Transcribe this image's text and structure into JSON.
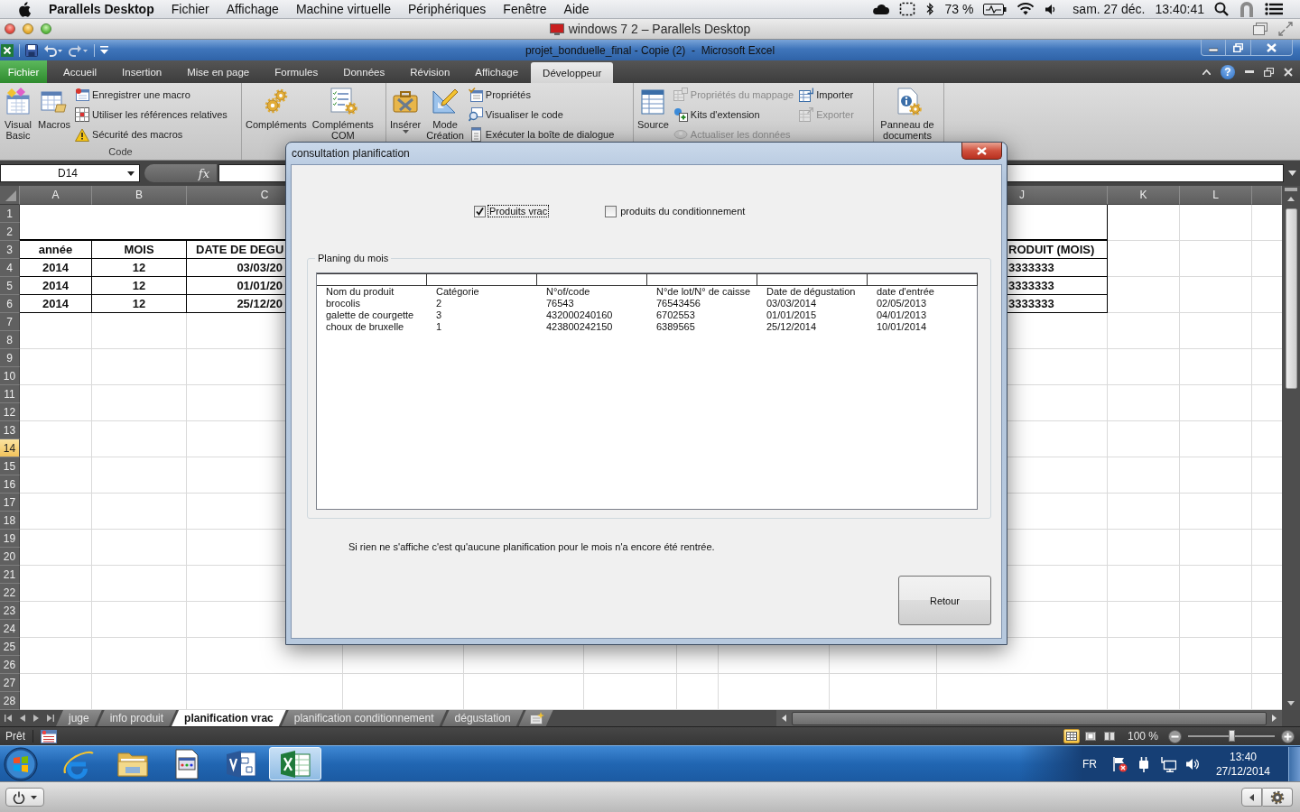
{
  "mac_menubar": {
    "app": "Parallels Desktop",
    "menus": [
      "Fichier",
      "Affichage",
      "Machine virtuelle",
      "Périphériques",
      "Fenêtre",
      "Aide"
    ],
    "battery": "73 %",
    "date": "sam. 27 déc.",
    "time": "13:40:41"
  },
  "vm_window": {
    "title": "windows 7 2 – Parallels Desktop"
  },
  "excel": {
    "title": "projet_bonduelle_final - Copie (2)  -  Microsoft Excel",
    "ribbon_tabs": [
      {
        "label": "Fichier",
        "kind": "file",
        "selected": false
      },
      {
        "label": "Accueil",
        "kind": "tab",
        "selected": false
      },
      {
        "label": "Insertion",
        "kind": "tab",
        "selected": false
      },
      {
        "label": "Mise en page",
        "kind": "tab",
        "selected": false
      },
      {
        "label": "Formules",
        "kind": "tab",
        "selected": false
      },
      {
        "label": "Données",
        "kind": "tab",
        "selected": false
      },
      {
        "label": "Révision",
        "kind": "tab",
        "selected": false
      },
      {
        "label": "Affichage",
        "kind": "tab",
        "selected": false
      },
      {
        "label": "Développeur",
        "kind": "tab",
        "selected": true
      }
    ],
    "help_label": "?",
    "ribbon_groups": [
      {
        "label": "Code",
        "items": [
          {
            "kind": "large",
            "label": "Visual Basic",
            "disabled": false,
            "menu": false
          },
          {
            "kind": "large",
            "label": "Macros",
            "disabled": false,
            "menu": false
          },
          {
            "kind": "small",
            "label": "Enregistrer une macro",
            "disabled": false,
            "menu": false
          },
          {
            "kind": "small",
            "label": "Utiliser les références relatives",
            "disabled": false,
            "menu": false
          },
          {
            "kind": "small",
            "label": "Sécurité des macros",
            "disabled": false,
            "menu": false
          }
        ]
      },
      {
        "items": [
          {
            "kind": "large",
            "label": "Compléments",
            "disabled": false,
            "menu": false
          },
          {
            "kind": "large",
            "label": "Compléments COM",
            "disabled": false,
            "menu": false
          }
        ]
      },
      {
        "items": [
          {
            "kind": "large",
            "label": "Insérer",
            "disabled": false,
            "menu": true
          },
          {
            "kind": "large",
            "label": "Mode Création",
            "disabled": false,
            "menu": false
          },
          {
            "kind": "small",
            "label": "Propriétés",
            "disabled": false,
            "menu": false
          },
          {
            "kind": "small",
            "label": "Visualiser le code",
            "disabled": false,
            "menu": false
          },
          {
            "kind": "small",
            "label": "Exécuter la boîte de dialogue",
            "disabled": false,
            "menu": false
          }
        ]
      },
      {
        "items": [
          {
            "kind": "large",
            "label": "Source",
            "disabled": false,
            "menu": false
          },
          {
            "kind": "small",
            "label": "Propriétés du mappage",
            "disabled": true,
            "menu": false
          },
          {
            "kind": "small",
            "label": "Kits d'extension",
            "disabled": false,
            "menu": false
          },
          {
            "kind": "small",
            "label": "Actualiser les données",
            "disabled": true,
            "menu": false
          },
          {
            "kind": "small",
            "label": "Importer",
            "disabled": false,
            "menu": false
          },
          {
            "kind": "small",
            "label": "Exporter",
            "disabled": true,
            "menu": false
          }
        ]
      },
      {
        "items": [
          {
            "kind": "large",
            "label": "Panneau de documents",
            "disabled": false,
            "menu": false
          }
        ]
      }
    ],
    "name_box": "D14",
    "function_label": "fx",
    "sheet": {
      "columns": [
        "A",
        "B",
        "C",
        "J",
        "K",
        "L"
      ],
      "rows": [
        {
          "number": "1",
          "selected": false
        },
        {
          "number": "2",
          "selected": false
        },
        {
          "number": "3",
          "selected": false
        },
        {
          "number": "4",
          "selected": false
        },
        {
          "number": "5",
          "selected": false
        },
        {
          "number": "6",
          "selected": false
        },
        {
          "number": "7",
          "selected": false
        },
        {
          "number": "8",
          "selected": false
        },
        {
          "number": "9",
          "selected": false
        },
        {
          "number": "10",
          "selected": false
        },
        {
          "number": "11",
          "selected": false
        },
        {
          "number": "12",
          "selected": false
        },
        {
          "number": "13",
          "selected": false
        },
        {
          "number": "14",
          "selected": true
        },
        {
          "number": "15",
          "selected": false
        },
        {
          "number": "16",
          "selected": false
        },
        {
          "number": "17",
          "selected": false
        },
        {
          "number": "18",
          "selected": false
        },
        {
          "number": "19",
          "selected": false
        },
        {
          "number": "20",
          "selected": false
        },
        {
          "number": "21",
          "selected": false
        },
        {
          "number": "22",
          "selected": false
        },
        {
          "number": "23",
          "selected": false
        },
        {
          "number": "24",
          "selected": false
        },
        {
          "number": "25",
          "selected": false
        },
        {
          "number": "26",
          "selected": false
        },
        {
          "number": "27",
          "selected": false
        },
        {
          "number": "28",
          "selected": false
        }
      ],
      "table": {
        "header": [
          "année",
          "MOIS",
          "DATE DE DEGU",
          "RODUIT (MOIS)"
        ],
        "rows": [
          [
            "2014",
            "12",
            "03/03/20",
            "3333333"
          ],
          [
            "2014",
            "12",
            "01/01/20",
            "3333333"
          ],
          [
            "2014",
            "12",
            "25/12/20",
            "3333333"
          ]
        ]
      }
    },
    "sheet_tabs": [
      {
        "label": "juge",
        "selected": false
      },
      {
        "label": "info produit",
        "selected": false
      },
      {
        "label": "planification vrac",
        "selected": true
      },
      {
        "label": "planification conditionnement",
        "selected": false
      },
      {
        "label": "dégustation",
        "selected": false
      }
    ],
    "status": {
      "text": "Prêt",
      "views": [
        {
          "selected": true
        },
        {
          "selected": false
        },
        {
          "selected": false
        }
      ],
      "zoom": {
        "reading": "100 %",
        "level": 0.5
      }
    }
  },
  "dialog": {
    "title": "consultation planification",
    "options": [
      {
        "label": "Produits vrac",
        "checked": true,
        "focused": true
      },
      {
        "label": "produits du conditionnement",
        "checked": false,
        "focused": false
      }
    ],
    "group": {
      "title": "Planing du mois",
      "rows": [
        [
          "Nom du produit",
          "Catégorie",
          "N°of/code",
          "N°de lot/N° de caisse",
          "Date de dégustation",
          "date d'entrée"
        ],
        [
          "brocolis",
          "2",
          "76543",
          "76543456",
          "03/03/2014",
          "02/05/2013"
        ],
        [
          "galette de courgette",
          "3",
          "432000240160",
          "6702553",
          "01/01/2015",
          "04/01/2013"
        ],
        [
          "choux de bruxelle",
          "1",
          "423800242150",
          "6389565",
          "25/12/2014",
          "10/01/2014"
        ]
      ]
    },
    "message": "Si rien ne s'affiche c'est qu'aucune planification pour le mois n'a encore été rentrée.",
    "button": "Retour"
  },
  "taskbar": {
    "apps": [
      {
        "kind": "browser",
        "selected": false
      },
      {
        "kind": "folder",
        "selected": false
      },
      {
        "kind": "document",
        "selected": false
      },
      {
        "kind": "diagram",
        "selected": false
      },
      {
        "kind": "spreadsheet",
        "selected": true
      }
    ],
    "language": "FR",
    "time": "13:40",
    "date": "27/12/2014"
  }
}
